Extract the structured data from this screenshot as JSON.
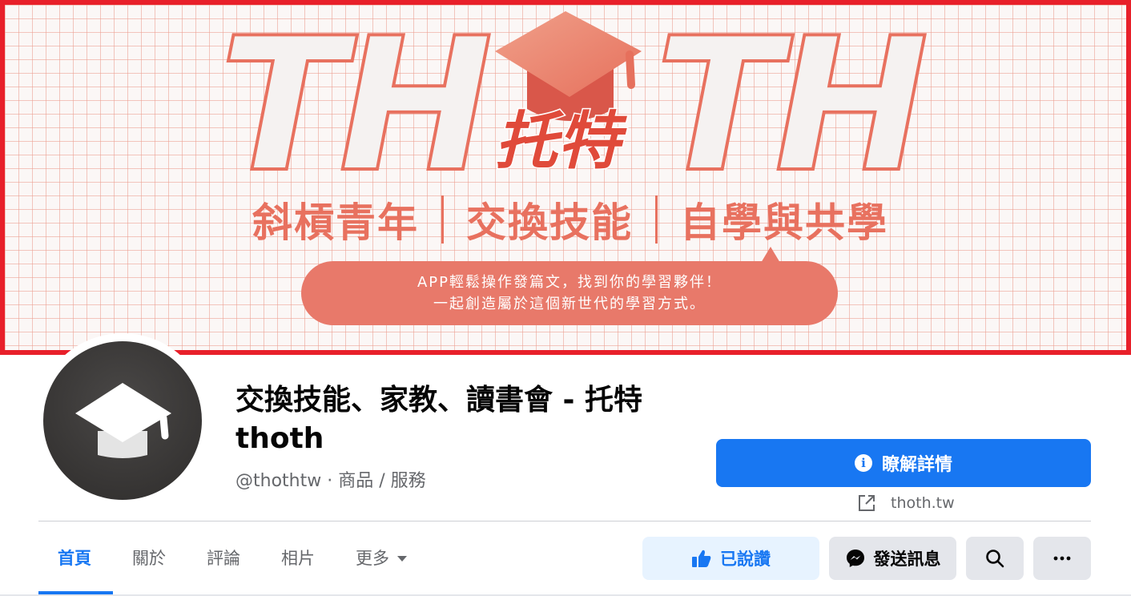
{
  "cover": {
    "logo_letters_left": "TH",
    "logo_letters_right": "TH",
    "logo_chinese": "托特",
    "slogans": [
      "斜槓青年",
      "交換技能",
      "自學與共學"
    ],
    "bubble_line1": "APP輕鬆操作發篇文，找到你的學習夥伴！",
    "bubble_line2": "一起創造屬於這個新世代的學習方式。",
    "accent_color": "#e8715f",
    "border_color": "#e8202a"
  },
  "profile": {
    "title": "交換技能、家教、讀書會 - 托特 thoth",
    "handle_line": "@thothtw · 商品 / 服務",
    "avatar_icon": "graduation-cap-icon"
  },
  "actions": {
    "learn_more": "瞭解詳情",
    "website": "thoth.tw",
    "liked": "已說讚",
    "send_message": "發送訊息",
    "search_icon": "search-icon",
    "more_icon": "more-icon"
  },
  "tabs": [
    {
      "label": "首頁",
      "active": true
    },
    {
      "label": "關於",
      "active": false
    },
    {
      "label": "評論",
      "active": false
    },
    {
      "label": "相片",
      "active": false
    },
    {
      "label": "更多",
      "active": false
    }
  ],
  "colors": {
    "primary": "#1877f2",
    "liked_bg": "#e7f3ff",
    "secondary_bg": "#e4e6eb",
    "muted_text": "#65676b"
  }
}
